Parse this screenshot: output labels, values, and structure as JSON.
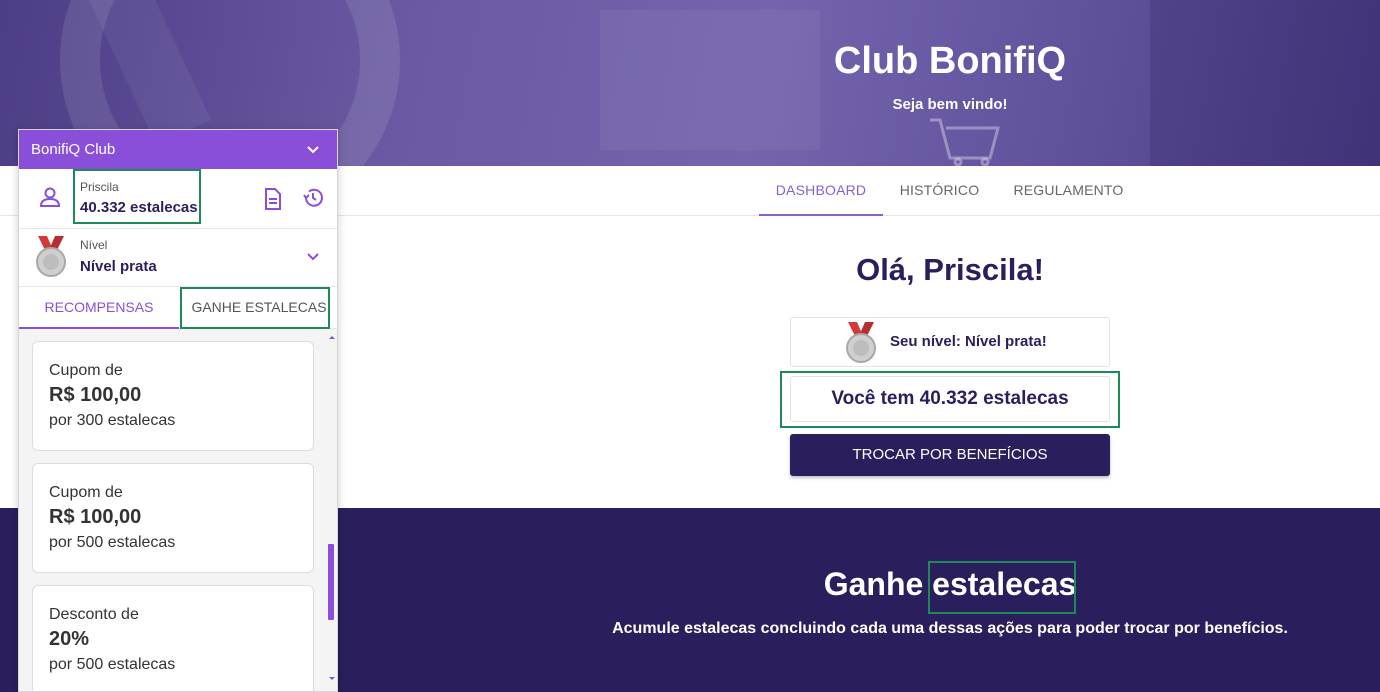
{
  "hero": {
    "title": "Club BonifiQ",
    "subtitle": "Seja bem vindo!"
  },
  "nav": {
    "tabs": [
      {
        "label": "DASHBOARD",
        "active": true
      },
      {
        "label": "HISTÓRICO"
      },
      {
        "label": "REGULAMENTO"
      }
    ]
  },
  "main": {
    "greeting": "Olá, Priscila!",
    "level_text": "Seu nível: Nível prata!",
    "points_text": "Você tem 40.332 estalecas",
    "cta_label": "TROCAR POR BENEFÍCIOS"
  },
  "earn": {
    "title": "Ganhe estalecas",
    "subtitle": "Acumule estalecas concluindo cada uma dessas ações para poder trocar por benefícios."
  },
  "widget": {
    "header_title": "BonifiQ Club",
    "user_name": "Priscila",
    "user_points": "40.332 estalecas",
    "level_label": "Nível",
    "level_value": "Nível prata",
    "tabs": [
      {
        "label": "RECOMPENSAS",
        "active": true
      },
      {
        "label": "GANHE ESTALECAS"
      }
    ],
    "rewards": [
      {
        "line1": "Cupom de",
        "line2": "R$ 100,00",
        "line3": "por 300 estalecas"
      },
      {
        "line1": "Cupom de",
        "line2": "R$ 100,00",
        "line3": "por 500 estalecas"
      },
      {
        "line1": "Desconto de",
        "line2": "20%",
        "line3": "por 500 estalecas"
      }
    ]
  },
  "colors": {
    "brand_purple": "#8a4fd8",
    "dark_navy": "#2a1f5c",
    "highlight_green": "#1d8a5a"
  },
  "icons": [
    "user-icon",
    "document-icon",
    "history-icon",
    "chevron-down-icon",
    "medal-icon"
  ]
}
